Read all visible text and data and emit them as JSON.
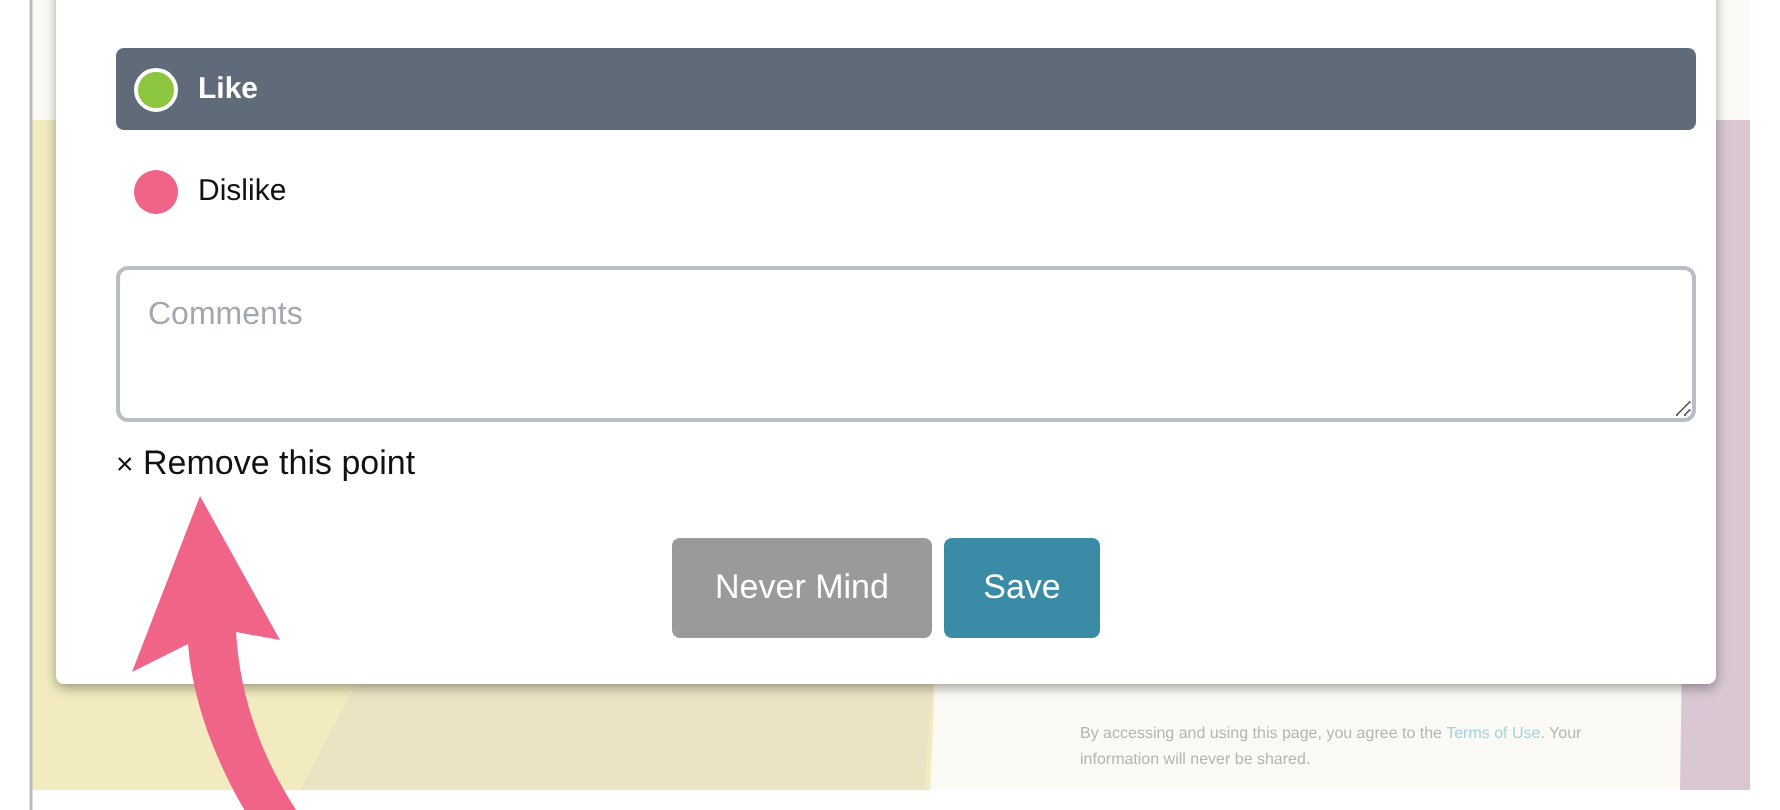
{
  "options": [
    {
      "label": "Like",
      "color": "#8cc63f",
      "selected": true
    },
    {
      "label": "Dislike",
      "color": "#f06488",
      "selected": false
    }
  ],
  "comments": {
    "placeholder": "Comments"
  },
  "remove_link": {
    "icon": "×",
    "label": "Remove this point"
  },
  "buttons": [
    {
      "label": "Never Mind",
      "kind": "cancel"
    },
    {
      "label": "Save",
      "kind": "primary"
    }
  ],
  "footer": {
    "before": "By accessing and using this page, you agree to the",
    "link": "Terms of Use",
    "after": ". Your information will never be shared."
  }
}
